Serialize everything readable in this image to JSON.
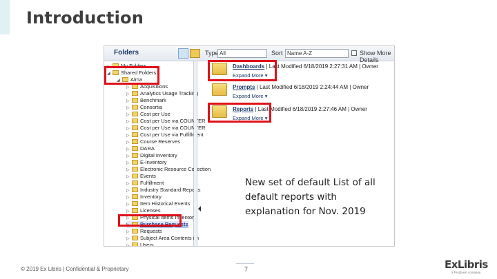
{
  "slide": {
    "title": "Introduction",
    "callout": "New set of default List of all default reports with explanation for Nov. 2019",
    "footer": "© 2019 Ex Libris | Confidential & Proprietary",
    "page_number": "7",
    "logo_text": "ExLibris",
    "logo_subtext": "a ProQuest company"
  },
  "catalog": {
    "panel_title": "Folders",
    "type_label": "Type",
    "type_value": "All",
    "sort_label": "Sort",
    "sort_value": "Name A-Z",
    "show_more_label": "Show More Details",
    "tree": [
      {
        "label": "My Folders",
        "depth": 0,
        "expanded": false
      },
      {
        "label": "Shared Folders",
        "depth": 0,
        "expanded": true
      },
      {
        "label": "Alma",
        "depth": 1,
        "expanded": true
      },
      {
        "label": "Acquisitions",
        "depth": 2
      },
      {
        "label": "Analytics Usage Tracking",
        "depth": 2
      },
      {
        "label": "Benchmark",
        "depth": 2
      },
      {
        "label": "Consortia",
        "depth": 2
      },
      {
        "label": "Cost per Use",
        "depth": 2
      },
      {
        "label": "Cost per Use via COUNTER",
        "depth": 2
      },
      {
        "label": "Cost per Use via COUNTER",
        "depth": 2
      },
      {
        "label": "Cost per Use via Fulfillment",
        "depth": 2
      },
      {
        "label": "Course Reserves",
        "depth": 2
      },
      {
        "label": "DARA",
        "depth": 2
      },
      {
        "label": "Digital Inventory",
        "depth": 2
      },
      {
        "label": "E-Inventory",
        "depth": 2
      },
      {
        "label": "Electronic Resource Collection",
        "depth": 2
      },
      {
        "label": "Events",
        "depth": 2
      },
      {
        "label": "Fulfillment",
        "depth": 2
      },
      {
        "label": "Industry Standard Reports",
        "depth": 2
      },
      {
        "label": "Inventory",
        "depth": 2
      },
      {
        "label": "Item Historical Events",
        "depth": 2
      },
      {
        "label": "Licenses",
        "depth": 2
      },
      {
        "label": "Physical Items Inventory",
        "depth": 2
      },
      {
        "label": "Purchase Requests",
        "depth": 2,
        "selected": true
      },
      {
        "label": "Requests",
        "depth": 2
      },
      {
        "label": "Subject Area Contents (in",
        "depth": 2
      },
      {
        "label": "Users",
        "depth": 2
      }
    ],
    "items": [
      {
        "name": "Dashboards",
        "meta": "Last Modified 6/18/2019 2:27:31 AM | Owner",
        "actions": "Expand  More ▾"
      },
      {
        "name": "Prompts",
        "meta": "Last Modified 6/18/2019 2:24:44 AM | Owner",
        "actions": "Expand  More ▾"
      },
      {
        "name": "Reports",
        "meta": "Last Modified 6/18/2019 2:27:46 AM | Owner",
        "actions": "Expand  More ▾"
      }
    ]
  }
}
